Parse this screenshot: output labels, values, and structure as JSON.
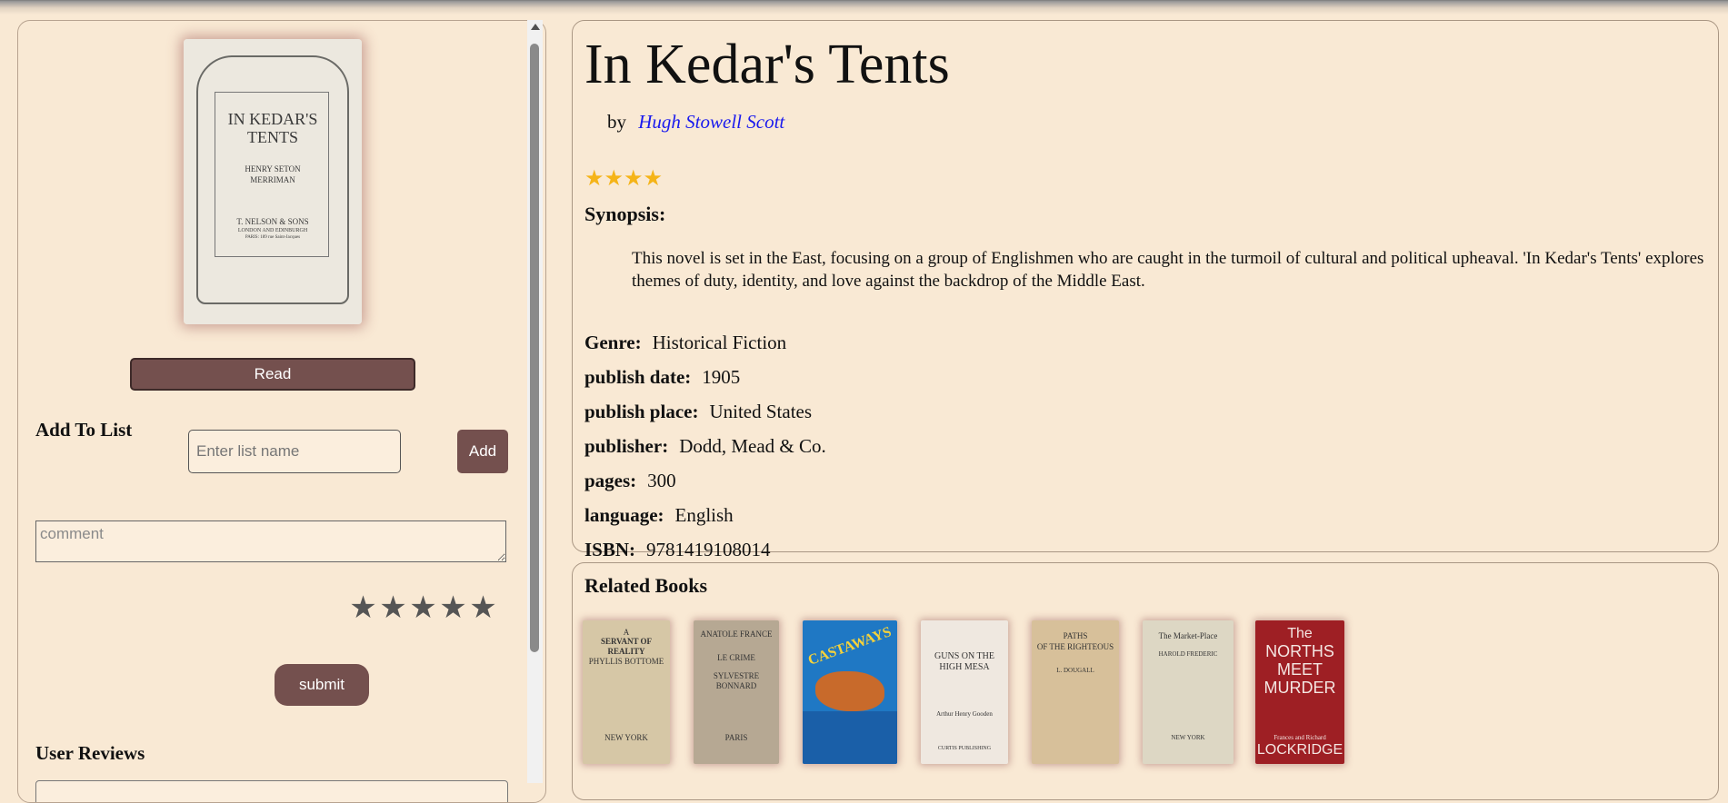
{
  "book": {
    "title": "In Kedar's Tents",
    "by_label": "by",
    "author": "Hugh Stowell Scott",
    "rating": 4,
    "rating_max": 5,
    "synopsis_label": "Synopsis:",
    "synopsis": "This novel is set in the East, focusing on a group of Englishmen who are caught in the turmoil of cultural and political upheaval. 'In Kedar's Tents' explores themes of duty, identity, and love against the backdrop of the Middle East.",
    "fields": [
      {
        "label": "Genre:",
        "value": "Historical Fiction"
      },
      {
        "label": "publish date:",
        "value": "1905"
      },
      {
        "label": "publish place:",
        "value": "United States"
      },
      {
        "label": "publisher:",
        "value": "Dodd, Mead & Co."
      },
      {
        "label": "pages:",
        "value": "300"
      },
      {
        "label": "language:",
        "value": "English"
      },
      {
        "label": "ISBN:",
        "value": "9781419108014"
      }
    ]
  },
  "cover": {
    "title_line1": "IN KEDAR'S",
    "title_line2": "TENTS",
    "author_line1": "HENRY SETON",
    "author_line2": "MERRIMAN",
    "publisher_line1": "T. NELSON & SONS",
    "publisher_line2": "LONDON AND EDINBURGH",
    "publisher_line3": "PARIS: 189 rue Saint-Jacques"
  },
  "actions": {
    "read_label": "Read",
    "add_to_list_label": "Add To List",
    "list_placeholder": "Enter list name",
    "add_label": "Add",
    "comment_placeholder": "comment",
    "submit_label": "submit",
    "user_reviews_label": "User Reviews",
    "star_glyph": "★"
  },
  "related": {
    "title": "Related Books",
    "books": [
      {
        "line1": "A",
        "line2": "SERVANT OF REALITY",
        "line3": "PHYLLIS BOTTOME",
        "line4": "NEW YORK",
        "bg": "#d6c7a6"
      },
      {
        "line1": "ANATOLE FRANCE",
        "line2": "LE CRIME",
        "line3": "SYLVESTRE BONNARD",
        "line4": "PARIS",
        "bg": "#b6a893"
      },
      {
        "line1": "CASTAWAYS",
        "line2": "",
        "line3": "",
        "line4": "",
        "bg": "#1f78c4"
      },
      {
        "line1": "GUNS ON THE",
        "line2": "HIGH MESA",
        "line3": "Arthur Henry Gooden",
        "line4": "CURTIS PUBLISHING",
        "bg": "#efe8e0"
      },
      {
        "line1": "PATHS",
        "line2": "OF THE RIGHTEOUS",
        "line3": "L. DOUGALL",
        "line4": "",
        "bg": "#d7c09a"
      },
      {
        "line1": "The Market-Place",
        "line2": "HAROLD FREDERIC",
        "line3": "",
        "line4": "NEW YORK",
        "bg": "#ddd7c4"
      },
      {
        "line1": "The",
        "line2": "NORTHS MEET MURDER",
        "line3": "Frances and Richard",
        "line4": "LOCKRIDGE",
        "bg": "#9e1f24"
      }
    ]
  }
}
